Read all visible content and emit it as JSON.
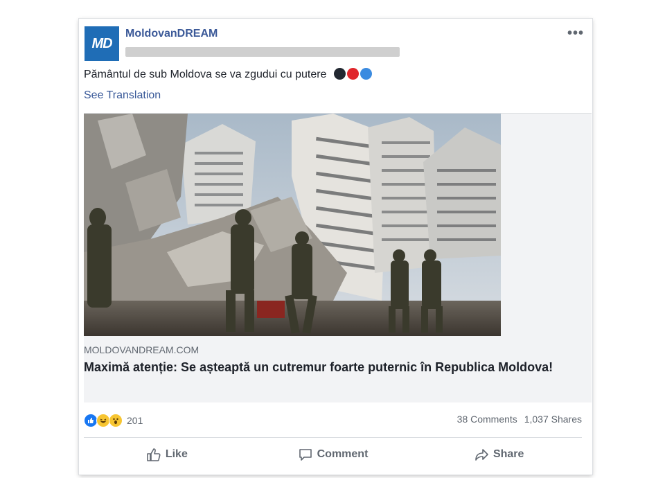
{
  "post": {
    "logo_text": "MD",
    "page_name": "MoldovanDREAM",
    "more_label": "•••",
    "text": "Pământul de sub Moldova se va zgudui cu putere",
    "emoji_colors": [
      "#222831",
      "#e0262b",
      "#3b8be0"
    ],
    "see_translation": "See Translation"
  },
  "link_preview": {
    "domain": "MOLDOVANDREAM.COM",
    "title": "Maximă atenție: Se așteaptă un cutremur foarte puternic în Republica Moldova!"
  },
  "stats": {
    "reaction_icons": [
      "like-icon",
      "haha-icon",
      "wow-icon"
    ],
    "reaction_count": "201",
    "comments": "38 Comments",
    "shares": "1,037 Shares"
  },
  "actions": {
    "like": "Like",
    "comment": "Comment",
    "share": "Share"
  },
  "colors": {
    "link_blue": "#3b5998",
    "logo_bg": "#1f6db6",
    "like_blue": "#1877f2"
  }
}
